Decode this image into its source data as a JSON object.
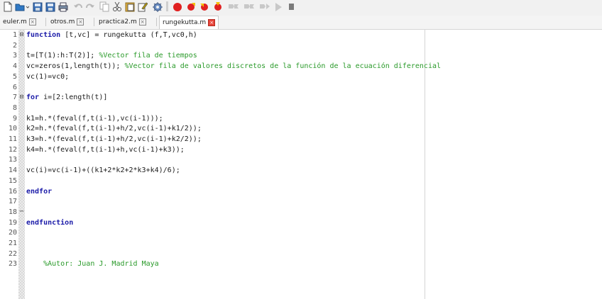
{
  "toolbar": {
    "icons": [
      "new-file-icon",
      "open-file-icon",
      "save-icon",
      "save-all-icon",
      "print-icon",
      "undo-icon",
      "redo-icon",
      "copy-icon",
      "cut-icon",
      "paste-icon",
      "edit-icon",
      "settings-icon",
      "breakpoint-icon",
      "debug-step-icon",
      "debug-step-in-icon",
      "debug-step-out-icon",
      "continue-icon",
      "run-icon",
      "stop-icon"
    ]
  },
  "tabs": [
    {
      "label": "euler.m",
      "active": false
    },
    {
      "label": "otros.m",
      "active": false
    },
    {
      "label": "practica2.m",
      "active": false
    },
    {
      "label": "rungekutta.m",
      "active": true
    }
  ],
  "colors": {
    "keyword": "#1a1aa8",
    "comment": "#2a9a2a",
    "active_tab_close": "#e8463b"
  },
  "lines": [
    {
      "n": "1",
      "fold": "⊟",
      "segments": [
        {
          "t": "function",
          "c": "kw"
        },
        {
          "t": " [t,vc] = rungekutta (f,T,vc0,h)",
          "c": ""
        }
      ]
    },
    {
      "n": "2",
      "fold": "",
      "segments": []
    },
    {
      "n": "3",
      "fold": "",
      "segments": [
        {
          "t": "t=[T(1):h:T(2)]; ",
          "c": ""
        },
        {
          "t": "%Vector fila de tiempos",
          "c": "cm"
        }
      ]
    },
    {
      "n": "4",
      "fold": "",
      "segments": [
        {
          "t": "vc=zeros(1,length(t)); ",
          "c": ""
        },
        {
          "t": "%Vector fila de valores discretos de la función de la ecuación diferencial",
          "c": "cm"
        }
      ]
    },
    {
      "n": "5",
      "fold": "",
      "segments": [
        {
          "t": "vc(1)=vc0;",
          "c": ""
        }
      ]
    },
    {
      "n": "6",
      "fold": "",
      "segments": []
    },
    {
      "n": "7",
      "fold": "⊟",
      "segments": [
        {
          "t": "for",
          "c": "kw"
        },
        {
          "t": " i=[2:length(t)]",
          "c": ""
        }
      ]
    },
    {
      "n": "8",
      "fold": "",
      "segments": []
    },
    {
      "n": "9",
      "fold": "",
      "segments": [
        {
          "t": "k1=h.*(feval(f,t(i-1),vc(i-1)));",
          "c": ""
        }
      ]
    },
    {
      "n": "10",
      "fold": "",
      "segments": [
        {
          "t": "k2=h.*(feval(f,t(i-1)+h/2,vc(i-1)+k1/2));",
          "c": ""
        }
      ]
    },
    {
      "n": "11",
      "fold": "",
      "segments": [
        {
          "t": "k3=h.*(feval(f,t(i-1)+h/2,vc(i-1)+k2/2));",
          "c": ""
        }
      ]
    },
    {
      "n": "12",
      "fold": "",
      "segments": [
        {
          "t": "k4=h.*(feval(f,t(i-1)+h,vc(i-1)+k3));",
          "c": ""
        }
      ]
    },
    {
      "n": "13",
      "fold": "",
      "segments": []
    },
    {
      "n": "14",
      "fold": "",
      "segments": [
        {
          "t": "vc(i)=vc(i-1)+((k1+2*k2+2*k3+k4)/6);",
          "c": ""
        }
      ]
    },
    {
      "n": "15",
      "fold": "",
      "segments": []
    },
    {
      "n": "16",
      "fold": "",
      "segments": [
        {
          "t": "endfor",
          "c": "kw"
        }
      ]
    },
    {
      "n": "17",
      "fold": "",
      "segments": []
    },
    {
      "n": "18",
      "fold": "─",
      "segments": []
    },
    {
      "n": "19",
      "fold": "",
      "segments": [
        {
          "t": "endfunction",
          "c": "kw"
        }
      ]
    },
    {
      "n": "20",
      "fold": "",
      "segments": []
    },
    {
      "n": "21",
      "fold": "",
      "segments": []
    },
    {
      "n": "22",
      "fold": "",
      "segments": []
    },
    {
      "n": "23",
      "fold": "",
      "segments": [
        {
          "t": "    ",
          "c": ""
        },
        {
          "t": "%Autor: Juan J. Madrid Maya",
          "c": "cm"
        }
      ]
    }
  ]
}
